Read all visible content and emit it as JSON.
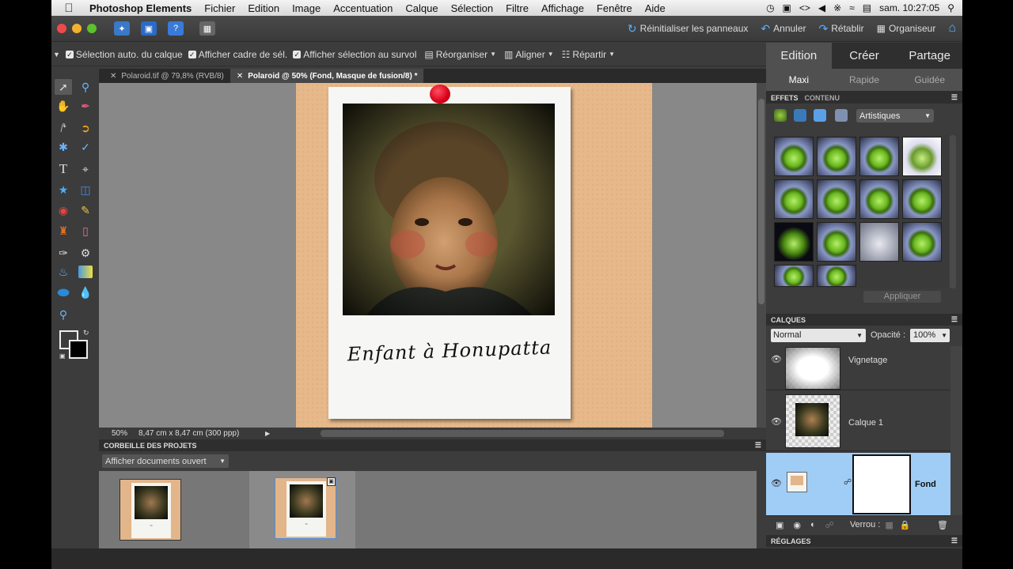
{
  "menubar": {
    "app_name": "Photoshop Elements",
    "items": [
      "Fichier",
      "Edition",
      "Image",
      "Accentuation",
      "Calque",
      "Sélection",
      "Filtre",
      "Affichage",
      "Fenêtre",
      "Aide"
    ],
    "clock": "sam. 10:27:05"
  },
  "topbar": {
    "reset_panels": "Réinitialiser les panneaux",
    "undo": "Annuler",
    "redo": "Rétablir",
    "organizer": "Organiseur"
  },
  "options": {
    "auto_select": "Sélection auto. du calque",
    "show_bbox": "Afficher cadre de sél.",
    "show_hover": "Afficher sélection au survol",
    "arrange": "Réorganiser",
    "align": "Aligner",
    "distribute": "Répartir"
  },
  "doc_tabs": [
    {
      "label": "Polaroid.tif @ 79,8% (RVB/8)"
    },
    {
      "label": "Polaroid @ 50% (Fond, Masque de fusion/8) *"
    }
  ],
  "canvas": {
    "caption": "Enfant à Honupatta"
  },
  "status": {
    "zoom": "50%",
    "doc_size": "8,47 cm x 8,47 cm (300 ppp)"
  },
  "project_bin": {
    "title": "CORBEILLE DES PROJETS",
    "filter": "Afficher documents ouvert"
  },
  "right_tabs": {
    "main": [
      "Edition",
      "Créer",
      "Partage"
    ],
    "sub": [
      "Maxi",
      "Rapide",
      "Guidée"
    ]
  },
  "effects": {
    "tab_effects": "EFFETS",
    "tab_content": "CONTENU",
    "category": "Artistiques",
    "apply": "Appliquer"
  },
  "layers": {
    "title": "CALQUES",
    "blend_mode": "Normal",
    "opacity_label": "Opacité :",
    "opacity_value": "100%",
    "items": [
      {
        "name": "Vignetage"
      },
      {
        "name": "Calque 1"
      },
      {
        "name": "Fond"
      }
    ],
    "lock_label": "Verrou :"
  },
  "adjustments": {
    "title": "RÉGLAGES"
  }
}
